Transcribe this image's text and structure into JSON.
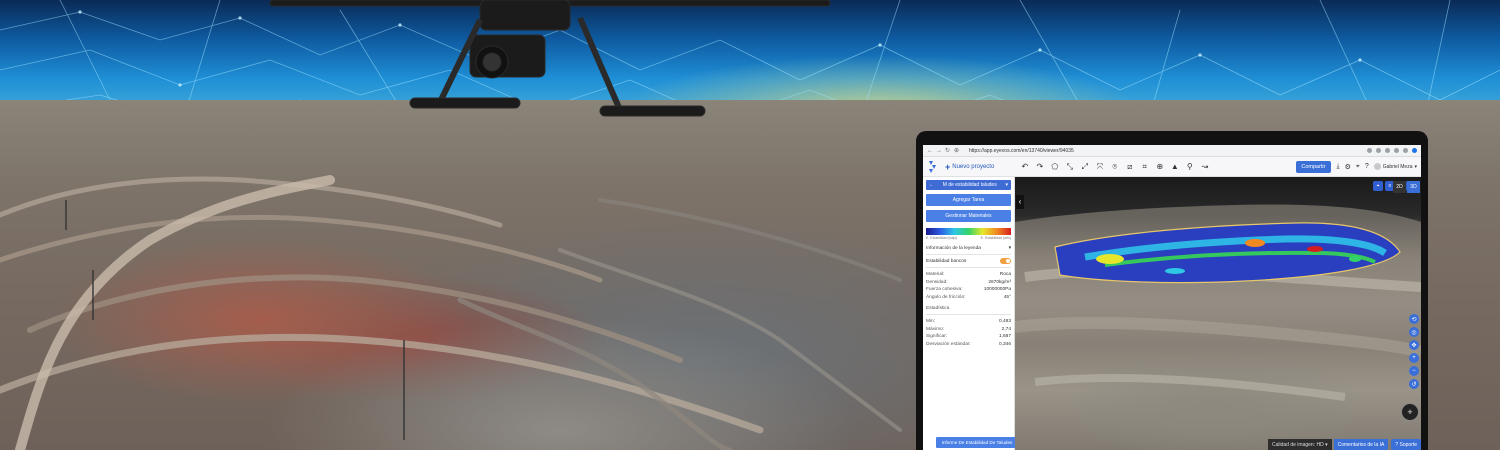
{
  "browser": {
    "url": "https://app.eyevos.com/en/13740/viewer/94035",
    "icons": [
      "back-arrow",
      "forward-arrow",
      "reload",
      "site-info"
    ]
  },
  "toolbar": {
    "new_project_label": "Nuevo proyecto",
    "share_label": "Compartir",
    "user_name": "Gabriel Meza",
    "tools": [
      "undo",
      "redo",
      "pentagon",
      "expand",
      "measure",
      "volume",
      "pin",
      "chart",
      "crop",
      "target",
      "mountain",
      "sensor",
      "path"
    ]
  },
  "sidepanel": {
    "layer_name": "M de estabilidad taludes",
    "add_task_label": "Agregar Tarea",
    "manage_materials_label": "Gestionar Materiales",
    "gradient_left_label": "E. Estabilidad (bajo)",
    "gradient_right_label": "E. Estabilidad (alto)",
    "legend_info_label": "Información de la leyenda",
    "layer_toggle_label": "Estabilidad bancos",
    "properties": [
      {
        "key": "Material:",
        "value": "Roca"
      },
      {
        "key": "Densidad:",
        "value": "2670kg/m³"
      },
      {
        "key": "Fuerza cohesiva:",
        "value": "10000000Pa"
      },
      {
        "key": "Ángulo de fricción:",
        "value": "45°"
      }
    ],
    "stats_title": "Estadística",
    "stats": [
      {
        "key": "Min:",
        "value": "0,483"
      },
      {
        "key": "Máximo:",
        "value": "2,74"
      },
      {
        "key": "Significar:",
        "value": "1,687"
      },
      {
        "key": "Desviación estándar:",
        "value": "0,346"
      }
    ],
    "report_label": "Informe De Estabilidad De Taludes"
  },
  "viewport": {
    "mode_2d": "2D",
    "mode_3d": "3D",
    "active_mode": "3D",
    "quality_label": "Calidad de imagen: HD",
    "ai_comments_label": "Comentarios de la IA",
    "support_label": "Soporte"
  },
  "colors": {
    "accent": "#3b6fd8",
    "toggle": "#f0a040"
  }
}
